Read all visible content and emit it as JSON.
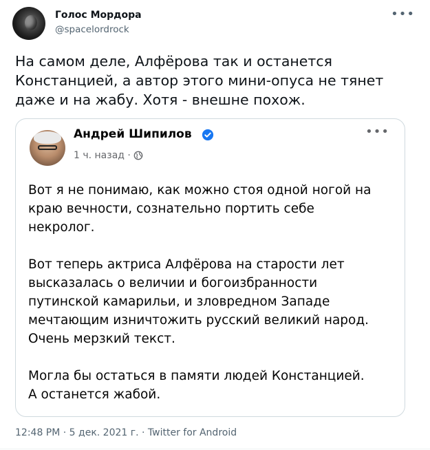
{
  "author": {
    "name": "Голос Мордора",
    "handle": "@spacelordrock"
  },
  "tweet": {
    "text": "На самом деле, Алфёрова так и останется\nКонстанцией, а автор этого мини-опуса не тянет\nдаже и на жабу. Хотя - внешне похож."
  },
  "quoted_post": {
    "author_name": "Андрей Шипилов",
    "time": "1 ч. назад ·",
    "paragraphs": [
      "Вот я не понимаю, как можно стоя одной ногой на\nкраю вечности, сознательно портить себе\nнекролог.",
      "Вот теперь актриса Алфёрова на старости лет\nвысказалась о величии и богоизбранности\nпутинской камарильи, и зловредном Западе\nмечтающим изничтожить русский великий народ.\nОчень мерзкий текст.",
      "Могла бы остаться в памяти людей Констанцией.\nА останется жабой."
    ]
  },
  "footer": {
    "meta": "12:48 PM · 5 дек. 2021 г. · Twitter for Android"
  },
  "colors": {
    "text": "#0f1419",
    "secondary": "#536471",
    "verified": "#1877f2",
    "border": "#cfd9de"
  },
  "icons": [
    "more-icon",
    "verified-badge-icon",
    "globe-icon"
  ]
}
